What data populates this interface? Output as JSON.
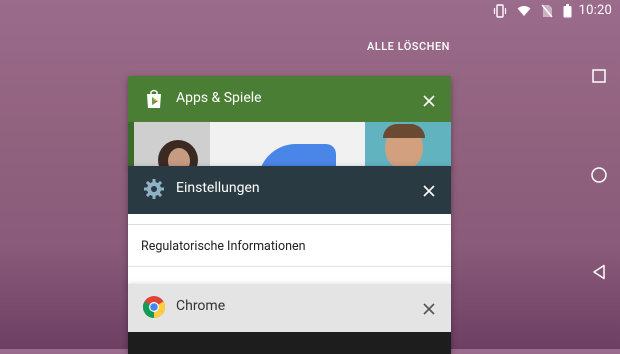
{
  "statusbar": {
    "time": "10:20",
    "icons": [
      "vibrate-icon",
      "wifi-icon",
      "no-sim-icon",
      "battery-icon"
    ]
  },
  "recents": {
    "clear_all_label": "ALLE LÖSCHEN",
    "cards": [
      {
        "title": "Apps & Spiele",
        "icon": "play-store-icon",
        "header_color": "#4b7e35"
      },
      {
        "title": "Einstellungen",
        "icon": "settings-gear-icon",
        "header_color": "#2a3a42",
        "content_item": "Regulatorische Informationen"
      },
      {
        "title": "Chrome",
        "icon": "chrome-icon",
        "header_color": "#e4e4e4"
      }
    ]
  },
  "navbar": {
    "buttons": [
      "overview-button",
      "home-button",
      "back-button"
    ]
  }
}
